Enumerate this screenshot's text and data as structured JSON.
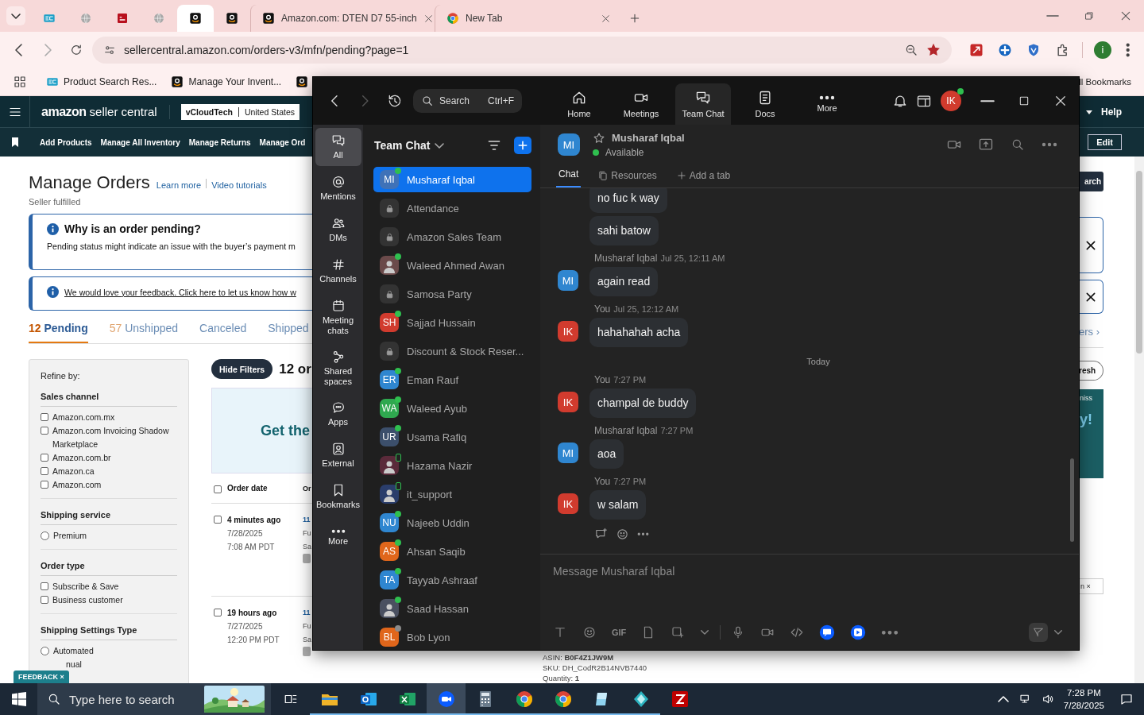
{
  "browser": {
    "tabs": [
      {
        "kind": "ec",
        "selected": false
      },
      {
        "kind": "globe",
        "selected": false
      },
      {
        "kind": "red",
        "selected": false
      },
      {
        "kind": "globe",
        "selected": false
      },
      {
        "kind": "amazon",
        "selected": true
      },
      {
        "kind": "amazon",
        "selected": false
      },
      {
        "kind": "amazon",
        "title": "Amazon.com: DTEN D7 55-inch",
        "selected": false
      },
      {
        "kind": "chrome",
        "title": "New Tab",
        "selected": false
      }
    ],
    "url": "sellercentral.amazon.com/orders-v3/mfn/pending?page=1",
    "bookmarked": true,
    "profile": "i",
    "bookmarks": [
      {
        "kind": "ec",
        "label": "Product Search Res..."
      },
      {
        "kind": "amazon",
        "label": "Manage Your Invent..."
      },
      {
        "kind": "amazon"
      }
    ],
    "all_bookmarks": "ll Bookmarks"
  },
  "amazon": {
    "logo": "amazon",
    "logo_suffix": "seller central",
    "store": "vCloudTech",
    "marketplace": "United States",
    "help": "Help",
    "nav": [
      "Add Products",
      "Manage All Inventory",
      "Manage Returns",
      "Manage Ord"
    ],
    "edit": "Edit",
    "title": "Manage Orders",
    "links": [
      "Learn more",
      "Video tutorials"
    ],
    "subtitle": "Seller fulfilled",
    "notice": {
      "title": "Why is an order pending?",
      "text": "Pending status might indicate an issue with the buyer’s payment m"
    },
    "feedback_notice": "We would love your feedback. Click here to let us know how w",
    "status_tabs": [
      {
        "count": "12",
        "label": "Pending",
        "selected": true
      },
      {
        "count": "57",
        "label": "Unshipped",
        "selected": false
      },
      {
        "label": "Canceled",
        "selected": false
      },
      {
        "label": "Shipped",
        "selected": false
      }
    ],
    "refine": "Refine by:",
    "filters": [
      {
        "title": "Sales channel",
        "kind": "checkbox",
        "options": [
          {
            "label": "Amazon.com.mx",
            "checked": false
          },
          {
            "label": "Amazon.com Invoicing Shadow Marketplace",
            "checked": false
          },
          {
            "label": "Amazon.com.br",
            "checked": false
          },
          {
            "label": "Amazon.ca",
            "checked": false
          },
          {
            "label": "Amazon.com",
            "checked": false
          }
        ]
      },
      {
        "title": "Shipping service",
        "kind": "radio",
        "options": [
          {
            "label": "Premium",
            "checked": false
          }
        ]
      },
      {
        "title": "Order type",
        "kind": "checkbox",
        "options": [
          {
            "label": "Subscribe & Save",
            "checked": false
          },
          {
            "label": "Business customer",
            "checked": false
          }
        ]
      },
      {
        "title": "Shipping Settings Type",
        "kind": "radio",
        "options": [
          {
            "label": "Automated",
            "checked": false
          },
          {
            "label": "nual"
          }
        ]
      }
    ],
    "hide_filters": "Hide Filters",
    "orders_count": "12 or",
    "banner": "Get the",
    "columns": [
      "Order date",
      "Or"
    ],
    "header_checked": false,
    "orders": [
      {
        "age": "4 minutes ago",
        "date": "7/28/2025",
        "time": "7:08 AM PDT",
        "column_2": [
          "11",
          "Fu",
          "Sa"
        ],
        "checked": false
      },
      {
        "age": "19 hours ago",
        "date": "7/27/2025",
        "time": "12:20 PM PDT",
        "column_2": [
          "11",
          "Fu",
          "Sa"
        ],
        "checked": false
      }
    ],
    "item_lines": [
      "ASIN: **B0F4Z1JW9M**",
      "SKU: DH_CodR2B14NVB7440",
      "Quantity: **1**"
    ],
    "feedback": "FEEDBACK ×",
    "edge": {
      "search": "arch",
      "more": "ers ›",
      "refresh": "resh",
      "promo_small": "niss",
      "promo_big": "y!",
      "chip": "n ×"
    }
  },
  "zoom": {
    "search": {
      "placeholder": "Search",
      "shortcut": "Ctrl+F"
    },
    "nav_tabs": [
      {
        "kind": "home",
        "label": "Home",
        "selected": false
      },
      {
        "kind": "video",
        "label": "Meetings",
        "selected": false
      },
      {
        "kind": "chat",
        "label": "Team Chat",
        "selected": true
      },
      {
        "kind": "docs",
        "label": "Docs",
        "selected": false
      },
      {
        "kind": "more",
        "label": "More",
        "selected": false
      }
    ],
    "user": {
      "initials": "IK",
      "color": "#d13b2e",
      "presence": {
        "kind": "dot",
        "color": "#2fbf4f"
      }
    },
    "sidebar": [
      {
        "kind": "chat",
        "label": "All",
        "selected": true
      },
      {
        "kind": "at",
        "label": "Mentions",
        "selected": false
      },
      {
        "kind": "people",
        "label": "DMs",
        "selected": false
      },
      {
        "kind": "hash",
        "label": "Channels",
        "selected": false
      },
      {
        "kind": "calendar",
        "label": "Meeting chats",
        "selected": false
      },
      {
        "kind": "nodes",
        "label": "Shared spaces",
        "selected": false
      },
      {
        "kind": "apps",
        "label": "Apps",
        "selected": false
      },
      {
        "kind": "contact",
        "label": "External",
        "selected": false
      },
      {
        "kind": "bookmark",
        "label": "Bookmarks",
        "selected": false
      },
      {
        "kind": "more",
        "label": "More",
        "selected": false
      }
    ],
    "list_title": "Team Chat",
    "contacts": [
      {
        "name": "Musharaf Iqbal",
        "kind": "initials",
        "initials": "MI",
        "color": "#3f72b8",
        "presence": {
          "kind": "dot",
          "color": "#2fbf4f"
        },
        "selected": true
      },
      {
        "name": "Attendance",
        "kind": "lock",
        "selected": false
      },
      {
        "name": "Amazon Sales Team",
        "kind": "lock",
        "selected": false
      },
      {
        "name": "Waleed Ahmed Awan",
        "color": "#6b4a4a",
        "presence": {
          "kind": "dot",
          "color": "#2fbf4f"
        },
        "selected": false
      },
      {
        "name": "Samosa Party",
        "kind": "lock",
        "selected": false
      },
      {
        "name": "Sajjad Hussain",
        "kind": "initials",
        "initials": "SH",
        "color": "#d13b2e",
        "presence": {
          "kind": "dot",
          "color": "#2fbf4f"
        },
        "selected": false
      },
      {
        "name": "Discount & Stock Reser...",
        "kind": "lock",
        "selected": false
      },
      {
        "name": "Eman Rauf",
        "kind": "initials",
        "initials": "ER",
        "color": "#2f86d0",
        "presence": {
          "kind": "dot",
          "color": "#2fbf4f"
        },
        "selected": false
      },
      {
        "name": "Waleed Ayub",
        "kind": "initials",
        "initials": "WA",
        "color": "#2fa84f",
        "presence": {
          "kind": "dot",
          "color": "#2fbf4f"
        },
        "selected": false
      },
      {
        "name": "Usama Rafiq",
        "kind": "initials",
        "initials": "UR",
        "color": "#3c4f6b",
        "presence": {
          "kind": "dot",
          "color": "#2fbf4f"
        },
        "selected": false
      },
      {
        "name": "Hazama Nazir",
        "color": "#5a2a3a",
        "presence": {
          "kind": "mobile",
          "color": "#2fbf4f"
        },
        "selected": false
      },
      {
        "name": "it_support",
        "color": "#2a3d6b",
        "presence": {
          "kind": "mobile",
          "color": "#2fbf4f"
        },
        "selected": false
      },
      {
        "name": "Najeeb Uddin",
        "kind": "initials",
        "initials": "NU",
        "color": "#2f86d0",
        "presence": {
          "kind": "dot",
          "color": "#2fbf4f"
        },
        "selected": false
      },
      {
        "name": "Ahsan Saqib",
        "kind": "initials",
        "initials": "AS",
        "color": "#e0661b",
        "presence": {
          "kind": "dot",
          "color": "#2fbf4f"
        },
        "selected": false
      },
      {
        "name": "Tayyab Ashraaf",
        "kind": "initials",
        "initials": "TA",
        "color": "#2f86d0",
        "presence": {
          "kind": "dot",
          "color": "#2fbf4f"
        },
        "selected": false
      },
      {
        "name": "Saad Hassan",
        "color": "#4a5060",
        "presence": {
          "kind": "dot",
          "color": "#2fbf4f"
        },
        "selected": false
      },
      {
        "name": "Bob Lyon",
        "kind": "initials",
        "initials": "BL",
        "color": "#e0661b",
        "presence": {
          "kind": "dot",
          "color": "#8a8a8a"
        },
        "selected": false
      }
    ],
    "chat": {
      "initials": "MI",
      "color": "#2f86d0",
      "name": "Musharaf Iqbal",
      "favorite": false,
      "status": "Available",
      "tabs": [
        {
          "kind": "plain",
          "label": "Chat",
          "selected": true
        },
        {
          "kind": "files",
          "label": "Resources",
          "selected": false
        },
        {
          "kind": "plus",
          "label": "Add a tab",
          "selected": false
        }
      ],
      "messages": [
        {
          "kind": "continued",
          "bubbles": [
            "no fuc k way",
            "sahi batow"
          ]
        },
        {
          "kind": "message",
          "initials": "MI",
          "color": "#2f86d0",
          "sender": "Musharaf Iqbal",
          "time": "Jul 25, 12:11 AM",
          "bubbles": [
            "again read"
          ]
        },
        {
          "kind": "message",
          "initials": "IK",
          "color": "#d13b2e",
          "sender": "You",
          "time": "Jul 25, 12:12 AM",
          "bubbles": [
            "hahahahah acha"
          ]
        },
        {
          "kind": "date",
          "label": "Today"
        },
        {
          "kind": "message",
          "initials": "IK",
          "color": "#d13b2e",
          "sender": "You",
          "time": "7:27 PM",
          "bubbles": [
            "champal de buddy"
          ]
        },
        {
          "kind": "message",
          "initials": "MI",
          "color": "#2f86d0",
          "sender": "Musharaf Iqbal",
          "time": "7:27 PM",
          "bubbles": [
            "aoa"
          ]
        },
        {
          "kind": "message",
          "initials": "IK",
          "color": "#d13b2e",
          "sender": "You",
          "time": "7:27 PM",
          "bubbles": [
            "w salam"
          ],
          "actions_shown": true
        }
      ],
      "placeholder": "Message Musharaf Iqbal",
      "gif": "GIF"
    }
  },
  "taskbar": {
    "search_placeholder": "Type here to search",
    "apps": [
      {
        "kind": "folder",
        "running": true,
        "active": false
      },
      {
        "kind": "outlook",
        "running": true,
        "active": false
      },
      {
        "kind": "excel",
        "running": true,
        "active": false
      },
      {
        "kind": "zoom",
        "running": true,
        "active": true
      },
      {
        "kind": "calc",
        "running": true,
        "active": false
      },
      {
        "kind": "chrome",
        "running": true,
        "active": false
      },
      {
        "kind": "chrome",
        "running": true,
        "active": false
      },
      {
        "kind": "glass",
        "running": true,
        "active": false
      },
      {
        "kind": "diamond",
        "running": true,
        "active": false
      },
      {
        "kind": "ftp",
        "running": false,
        "active": false
      }
    ],
    "time": "7:28 PM",
    "date": "7/28/2025"
  }
}
